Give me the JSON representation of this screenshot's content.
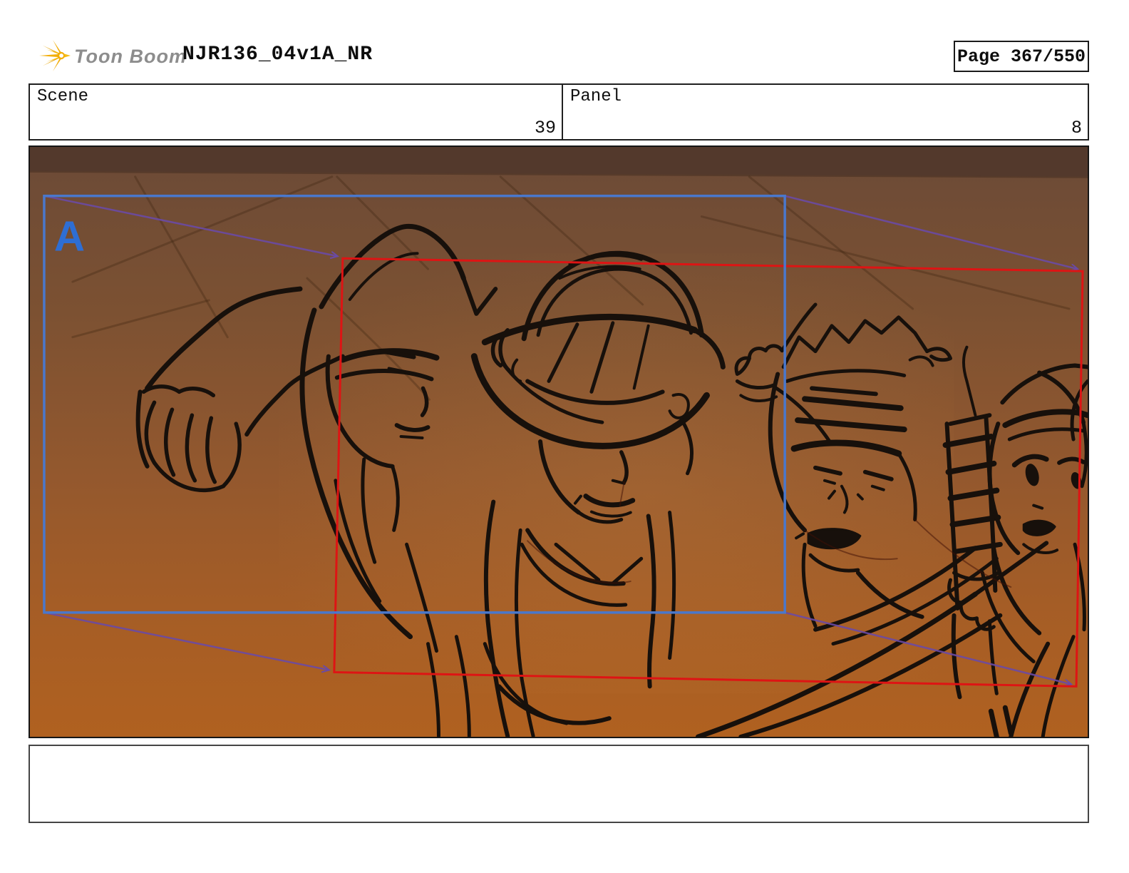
{
  "header": {
    "brand": "Toon Boom",
    "title": "NJR136_04v1A_NR",
    "page_label": "Page 367/550"
  },
  "info": {
    "scene_label": "Scene",
    "scene_value": "39",
    "panel_label": "Panel",
    "panel_value": "8"
  },
  "board": {
    "frame_a_label": "A",
    "caption": "",
    "colors": {
      "frame_a_blue": "#4a78cc",
      "frame_b_red": "#de1414",
      "camera_path_purple": "#6a4aa5",
      "label_a_blue": "#2e6ed4",
      "bg_top_brown": "#53392c",
      "bg_bottom_orange": "#b06120",
      "ink_black": "#17100b"
    }
  }
}
